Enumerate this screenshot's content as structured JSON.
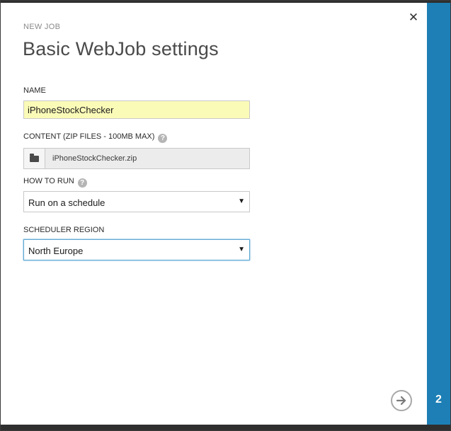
{
  "dialog": {
    "kicker": "NEW JOB",
    "title": "Basic WebJob settings",
    "close_icon": "close-icon",
    "step_number": "2",
    "next_icon": "arrow-right-circle-icon"
  },
  "fields": {
    "name": {
      "label": "NAME",
      "value": "iPhoneStockChecker"
    },
    "content": {
      "label": "CONTENT (ZIP FILES - 100MB MAX)",
      "file_name": "iPhoneStockChecker.zip",
      "help_icon": "help-icon",
      "browse_icon": "folder-icon"
    },
    "how_to_run": {
      "label": "HOW TO RUN",
      "value": "Run on a schedule",
      "help_icon": "help-icon"
    },
    "scheduler_region": {
      "label": "SCHEDULER REGION",
      "value": "North Europe"
    }
  },
  "glyphs": {
    "close": "✕",
    "dropdown": "▼",
    "help": "?"
  },
  "colors": {
    "accent": "#1d7fb5",
    "input_highlight": "#fbfbb8",
    "focus_border": "#5ba6d4"
  }
}
